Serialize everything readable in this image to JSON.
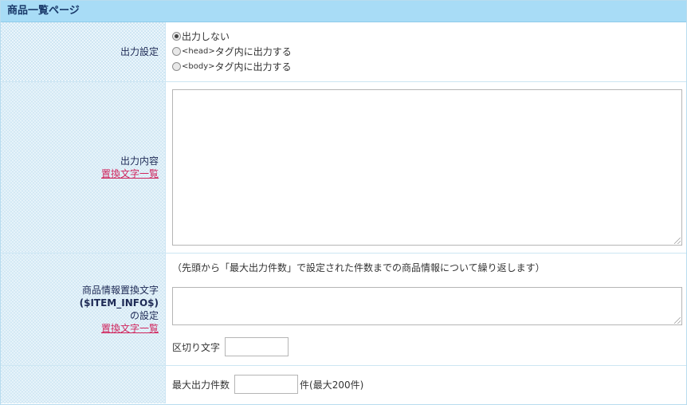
{
  "page": {
    "title": "商品一覧ページ"
  },
  "output_setting": {
    "label": "出力設定",
    "options": [
      {
        "label": "出力しない",
        "selected": true
      },
      {
        "tag": "<head>",
        "label": "タグ内に出力する",
        "selected": false
      },
      {
        "tag": "<body>",
        "label": "タグ内に出力する",
        "selected": false
      }
    ]
  },
  "output_content": {
    "label": "出力内容",
    "link": "置換文字一覧",
    "value": ""
  },
  "item_info": {
    "label_line1": "商品情報置換文字",
    "label_line2": "($ITEM_INFO$)",
    "label_line3": "の設定",
    "link": "置換文字一覧",
    "note": "（先頭から「最大出力件数」で設定された件数までの商品情報について繰り返します）",
    "value": "",
    "separator_label": "区切り文字",
    "separator_value": ""
  },
  "max_output": {
    "label": "最大出力件数",
    "value": "",
    "suffix": "件(最大200件)"
  }
}
